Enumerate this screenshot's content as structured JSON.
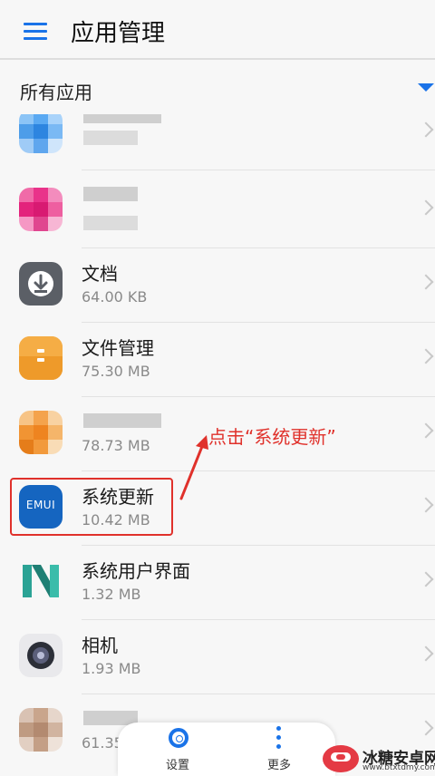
{
  "header": {
    "title": "应用管理"
  },
  "filter": {
    "label": "所有应用"
  },
  "apps": [
    {
      "name": "",
      "size": "",
      "blurred": true
    },
    {
      "name": "",
      "size": "",
      "blurred": true
    },
    {
      "name": "文档",
      "size": "64.00 KB"
    },
    {
      "name": "文件管理",
      "size": "75.30 MB"
    },
    {
      "name": "",
      "size": "78.73 MB",
      "blurred": true
    },
    {
      "name": "系统更新",
      "size": "10.42 MB"
    },
    {
      "name": "系统用户界面",
      "size": "1.32 MB"
    },
    {
      "name": "相机",
      "size": "1.93 MB"
    },
    {
      "name": "",
      "size": "61.35 MB",
      "blurred": true
    }
  ],
  "icons": {
    "row0": "blurred-app-icon",
    "row1": "blurred-app-icon",
    "docs": "download-icon",
    "files": "folder-icon",
    "row4": "blurred-app-icon",
    "update": "emui-icon",
    "systemui": "n-logo-icon",
    "camera": "camera-icon",
    "row8": "blurred-app-icon"
  },
  "update_icon_text": "EMUI",
  "annotation": {
    "text": "点击“系统更新”"
  },
  "bottom_nav": {
    "settings": "设置",
    "more": "更多"
  },
  "watermark": {
    "title": "冰糖安卓网",
    "url": "www.btxtdmy.com"
  },
  "colors": {
    "accent": "#1a73e8",
    "annotation": "#e0312b",
    "background": "#f7f7f7"
  }
}
